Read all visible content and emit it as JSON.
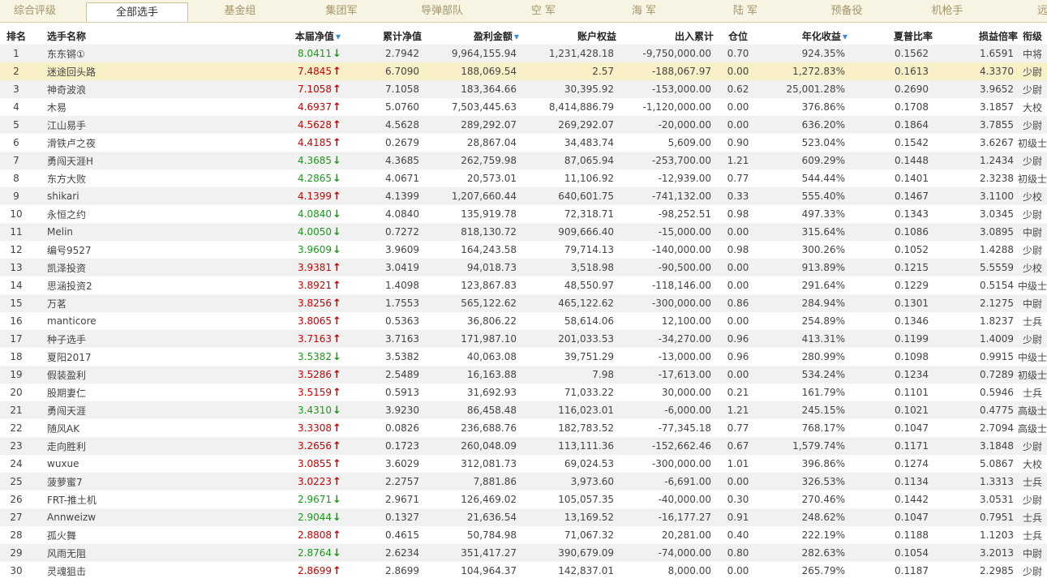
{
  "tabs": [
    {
      "label": "综合评级",
      "active": false
    },
    {
      "label": "全部选手",
      "active": true
    },
    {
      "label": "基金组",
      "active": false
    },
    {
      "label": "集团军",
      "active": false
    },
    {
      "label": "导弹部队",
      "active": false
    },
    {
      "label": "空 军",
      "active": false
    },
    {
      "label": "海 军",
      "active": false
    },
    {
      "label": "陆 军",
      "active": false
    },
    {
      "label": "预备役",
      "active": false
    },
    {
      "label": "机枪手",
      "active": false
    },
    {
      "label": "远程",
      "active": false
    }
  ],
  "colors": {
    "up": "#cc0000",
    "down": "#1a9a1a",
    "sort_indicator": "#3a8ed8",
    "highlight_row": "#faf0c8"
  },
  "columns": [
    {
      "key": "rank",
      "label": "排名",
      "sorted": false
    },
    {
      "key": "name",
      "label": "选手名称",
      "sorted": false
    },
    {
      "key": "week_nav",
      "label": "本届净值",
      "sorted": true
    },
    {
      "key": "cum_nav",
      "label": "累计净值",
      "sorted": false
    },
    {
      "key": "profit",
      "label": "盈利金额",
      "sorted": true
    },
    {
      "key": "equity",
      "label": "账户权益",
      "sorted": false
    },
    {
      "key": "inout",
      "label": "出入累计",
      "sorted": false
    },
    {
      "key": "position",
      "label": "仓位",
      "sorted": false
    },
    {
      "key": "annual",
      "label": "年化收益",
      "sorted": true
    },
    {
      "key": "sharpe",
      "label": "夏普比率",
      "sorted": false
    },
    {
      "key": "pl_ratio",
      "label": "损益倍率",
      "sorted": false
    },
    {
      "key": "rank_title",
      "label": "衔级",
      "sorted": false
    }
  ],
  "rows": [
    {
      "rank": "1",
      "name": "东东锵①",
      "week_nav": "8.0411",
      "trend": "down",
      "cum_nav": "2.7942",
      "profit": "9,964,155.94",
      "equity": "1,231,428.18",
      "inout": "-9,750,000.00",
      "position": "0.70",
      "annual": "924.35%",
      "sharpe": "0.1562",
      "pl_ratio": "1.6591",
      "rank_title": "中将"
    },
    {
      "rank": "2",
      "name": "迷途回头路",
      "week_nav": "7.4845",
      "trend": "up",
      "cum_nav": "6.7090",
      "profit": "188,069.54",
      "equity": "2.57",
      "inout": "-188,067.97",
      "position": "0.00",
      "annual": "1,272.83%",
      "sharpe": "0.1613",
      "pl_ratio": "4.3370",
      "rank_title": "少尉",
      "highlight": true
    },
    {
      "rank": "3",
      "name": "神奇波浪",
      "week_nav": "7.1058",
      "trend": "up",
      "cum_nav": "7.1058",
      "profit": "183,364.66",
      "equity": "30,395.92",
      "inout": "-153,000.00",
      "position": "0.62",
      "annual": "25,001.28%",
      "sharpe": "0.2690",
      "pl_ratio": "3.9652",
      "rank_title": "少尉"
    },
    {
      "rank": "4",
      "name": "木易",
      "week_nav": "4.6937",
      "trend": "up",
      "cum_nav": "5.0760",
      "profit": "7,503,445.63",
      "equity": "8,414,886.79",
      "inout": "-1,120,000.00",
      "position": "0.00",
      "annual": "376.86%",
      "sharpe": "0.1708",
      "pl_ratio": "3.1857",
      "rank_title": "大校"
    },
    {
      "rank": "5",
      "name": "江山易手",
      "week_nav": "4.5628",
      "trend": "up",
      "cum_nav": "4.5628",
      "profit": "289,292.07",
      "equity": "269,292.07",
      "inout": "-20,000.00",
      "position": "0.00",
      "annual": "636.20%",
      "sharpe": "0.1864",
      "pl_ratio": "3.7855",
      "rank_title": "少尉"
    },
    {
      "rank": "6",
      "name": "滑铁卢之夜",
      "week_nav": "4.4185",
      "trend": "up",
      "cum_nav": "0.2679",
      "profit": "28,867.04",
      "equity": "34,483.74",
      "inout": "5,609.00",
      "position": "0.90",
      "annual": "523.04%",
      "sharpe": "0.1542",
      "pl_ratio": "3.6267",
      "rank_title": "初级士官"
    },
    {
      "rank": "7",
      "name": "勇闯天涯H",
      "week_nav": "4.3685",
      "trend": "down",
      "cum_nav": "4.3685",
      "profit": "262,759.98",
      "equity": "87,065.94",
      "inout": "-253,700.00",
      "position": "1.21",
      "annual": "609.29%",
      "sharpe": "0.1448",
      "pl_ratio": "1.2434",
      "rank_title": "少尉"
    },
    {
      "rank": "8",
      "name": "东方大败",
      "week_nav": "4.2865",
      "trend": "down",
      "cum_nav": "4.0671",
      "profit": "20,573.01",
      "equity": "11,106.92",
      "inout": "-12,939.00",
      "position": "0.77",
      "annual": "544.44%",
      "sharpe": "0.1401",
      "pl_ratio": "2.3238",
      "rank_title": "初级士官"
    },
    {
      "rank": "9",
      "name": "shikari",
      "week_nav": "4.1399",
      "trend": "up",
      "cum_nav": "4.1399",
      "profit": "1,207,660.44",
      "equity": "640,601.75",
      "inout": "-741,132.00",
      "position": "0.33",
      "annual": "555.40%",
      "sharpe": "0.1467",
      "pl_ratio": "3.1100",
      "rank_title": "少校"
    },
    {
      "rank": "10",
      "name": "永恒之约",
      "week_nav": "4.0840",
      "trend": "down",
      "cum_nav": "4.0840",
      "profit": "135,919.78",
      "equity": "72,318.71",
      "inout": "-98,252.51",
      "position": "0.98",
      "annual": "497.33%",
      "sharpe": "0.1343",
      "pl_ratio": "3.0345",
      "rank_title": "少尉"
    },
    {
      "rank": "11",
      "name": "Melin",
      "week_nav": "4.0050",
      "trend": "down",
      "cum_nav": "0.7272",
      "profit": "818,130.72",
      "equity": "909,666.40",
      "inout": "-15,000.00",
      "position": "0.00",
      "annual": "315.64%",
      "sharpe": "0.1086",
      "pl_ratio": "3.0895",
      "rank_title": "中尉"
    },
    {
      "rank": "12",
      "name": "编号9527",
      "week_nav": "3.9609",
      "trend": "down",
      "cum_nav": "3.9609",
      "profit": "164,243.58",
      "equity": "79,714.13",
      "inout": "-140,000.00",
      "position": "0.98",
      "annual": "300.26%",
      "sharpe": "0.1052",
      "pl_ratio": "1.4288",
      "rank_title": "少尉"
    },
    {
      "rank": "13",
      "name": "凯泽投资",
      "week_nav": "3.9381",
      "trend": "up",
      "cum_nav": "3.0419",
      "profit": "94,018.73",
      "equity": "3,518.98",
      "inout": "-90,500.00",
      "position": "0.00",
      "annual": "913.89%",
      "sharpe": "0.1215",
      "pl_ratio": "5.5559",
      "rank_title": "少校"
    },
    {
      "rank": "14",
      "name": "思涵投资2",
      "week_nav": "3.8921",
      "trend": "up",
      "cum_nav": "1.4098",
      "profit": "123,867.83",
      "equity": "48,550.97",
      "inout": "-118,146.00",
      "position": "0.00",
      "annual": "291.64%",
      "sharpe": "0.1229",
      "pl_ratio": "0.5154",
      "rank_title": "中级士官"
    },
    {
      "rank": "15",
      "name": "万茗",
      "week_nav": "3.8256",
      "trend": "up",
      "cum_nav": "1.7553",
      "profit": "565,122.62",
      "equity": "465,122.62",
      "inout": "-300,000.00",
      "position": "0.86",
      "annual": "284.94%",
      "sharpe": "0.1301",
      "pl_ratio": "2.1275",
      "rank_title": "中尉"
    },
    {
      "rank": "16",
      "name": "manticore",
      "week_nav": "3.8065",
      "trend": "up",
      "cum_nav": "0.5363",
      "profit": "36,806.22",
      "equity": "58,614.06",
      "inout": "12,100.00",
      "position": "0.00",
      "annual": "254.89%",
      "sharpe": "0.1346",
      "pl_ratio": "1.8237",
      "rank_title": "士兵"
    },
    {
      "rank": "17",
      "name": "种子选手",
      "week_nav": "3.7163",
      "trend": "up",
      "cum_nav": "3.7163",
      "profit": "171,987.10",
      "equity": "201,033.53",
      "inout": "-34,270.00",
      "position": "0.96",
      "annual": "413.31%",
      "sharpe": "0.1199",
      "pl_ratio": "1.4009",
      "rank_title": "少尉"
    },
    {
      "rank": "18",
      "name": "夏阳2017",
      "week_nav": "3.5382",
      "trend": "down",
      "cum_nav": "3.5382",
      "profit": "40,063.08",
      "equity": "39,751.29",
      "inout": "-13,000.00",
      "position": "0.96",
      "annual": "280.99%",
      "sharpe": "0.1098",
      "pl_ratio": "0.9915",
      "rank_title": "中级士官"
    },
    {
      "rank": "19",
      "name": "假装盈利",
      "week_nav": "3.5286",
      "trend": "up",
      "cum_nav": "2.5489",
      "profit": "16,163.88",
      "equity": "7.98",
      "inout": "-17,613.00",
      "position": "0.00",
      "annual": "534.24%",
      "sharpe": "0.1234",
      "pl_ratio": "0.7289",
      "rank_title": "初级士官"
    },
    {
      "rank": "20",
      "name": "股期妻仁",
      "week_nav": "3.5159",
      "trend": "up",
      "cum_nav": "0.5913",
      "profit": "31,692.93",
      "equity": "71,033.22",
      "inout": "30,000.00",
      "position": "0.21",
      "annual": "161.79%",
      "sharpe": "0.1101",
      "pl_ratio": "0.5946",
      "rank_title": "士兵"
    },
    {
      "rank": "21",
      "name": "勇闯天涯",
      "week_nav": "3.4310",
      "trend": "down",
      "cum_nav": "3.9230",
      "profit": "86,458.48",
      "equity": "116,023.01",
      "inout": "-6,000.00",
      "position": "1.21",
      "annual": "245.15%",
      "sharpe": "0.1021",
      "pl_ratio": "0.4775",
      "rank_title": "高级士官"
    },
    {
      "rank": "22",
      "name": "随风AK",
      "week_nav": "3.3308",
      "trend": "up",
      "cum_nav": "0.0826",
      "profit": "236,688.76",
      "equity": "182,783.52",
      "inout": "-77,345.18",
      "position": "0.77",
      "annual": "768.17%",
      "sharpe": "0.1047",
      "pl_ratio": "2.7094",
      "rank_title": "高级士官"
    },
    {
      "rank": "23",
      "name": "走向胜利",
      "week_nav": "3.2656",
      "trend": "up",
      "cum_nav": "0.1723",
      "profit": "260,048.09",
      "equity": "113,111.36",
      "inout": "-152,662.46",
      "position": "0.67",
      "annual": "1,579.74%",
      "sharpe": "0.1171",
      "pl_ratio": "3.1848",
      "rank_title": "少尉"
    },
    {
      "rank": "24",
      "name": "wuxue",
      "week_nav": "3.0855",
      "trend": "up",
      "cum_nav": "3.6029",
      "profit": "312,081.73",
      "equity": "69,024.53",
      "inout": "-300,000.00",
      "position": "1.01",
      "annual": "396.86%",
      "sharpe": "0.1274",
      "pl_ratio": "5.0867",
      "rank_title": "大校"
    },
    {
      "rank": "25",
      "name": "菠萝蜜7",
      "week_nav": "3.0223",
      "trend": "up",
      "cum_nav": "2.2757",
      "profit": "7,881.86",
      "equity": "3,973.60",
      "inout": "-6,691.00",
      "position": "0.00",
      "annual": "326.53%",
      "sharpe": "0.1134",
      "pl_ratio": "1.3313",
      "rank_title": "士兵"
    },
    {
      "rank": "26",
      "name": "FRT-推土机",
      "week_nav": "2.9671",
      "trend": "down",
      "cum_nav": "2.9671",
      "profit": "126,469.02",
      "equity": "105,057.35",
      "inout": "-40,000.00",
      "position": "0.30",
      "annual": "270.46%",
      "sharpe": "0.1442",
      "pl_ratio": "3.0531",
      "rank_title": "少尉"
    },
    {
      "rank": "27",
      "name": "Annweizw",
      "week_nav": "2.9044",
      "trend": "down",
      "cum_nav": "0.1327",
      "profit": "21,636.54",
      "equity": "13,169.52",
      "inout": "-16,177.27",
      "position": "0.91",
      "annual": "248.62%",
      "sharpe": "0.1047",
      "pl_ratio": "0.7951",
      "rank_title": "士兵"
    },
    {
      "rank": "28",
      "name": "孤火舞",
      "week_nav": "2.8808",
      "trend": "up",
      "cum_nav": "0.4615",
      "profit": "50,784.98",
      "equity": "71,067.32",
      "inout": "20,281.00",
      "position": "0.40",
      "annual": "222.19%",
      "sharpe": "0.1188",
      "pl_ratio": "1.1203",
      "rank_title": "士兵"
    },
    {
      "rank": "29",
      "name": "风雨无阻",
      "week_nav": "2.8764",
      "trend": "down",
      "cum_nav": "2.6234",
      "profit": "351,417.27",
      "equity": "390,679.09",
      "inout": "-74,000.00",
      "position": "0.80",
      "annual": "282.63%",
      "sharpe": "0.1054",
      "pl_ratio": "3.2013",
      "rank_title": "中尉"
    },
    {
      "rank": "30",
      "name": "灵魂狙击",
      "week_nav": "2.8699",
      "trend": "up",
      "cum_nav": "2.8699",
      "profit": "104,964.37",
      "equity": "142,837.01",
      "inout": "8,000.00",
      "position": "0.00",
      "annual": "265.79%",
      "sharpe": "0.1187",
      "pl_ratio": "2.2985",
      "rank_title": "少尉"
    }
  ]
}
